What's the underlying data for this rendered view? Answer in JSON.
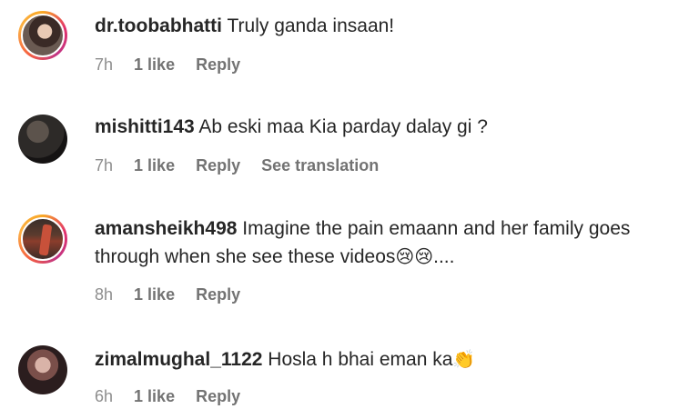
{
  "comments": [
    {
      "username": "dr.toobabhatti",
      "text": "Truly ganda insaan!",
      "time": "7h",
      "likes": "1 like",
      "reply": "Reply",
      "translate": ""
    },
    {
      "username": "mishitti143",
      "text": "Ab eski maa Kia parday dalay gi ?",
      "time": "7h",
      "likes": "1 like",
      "reply": "Reply",
      "translate": "See translation"
    },
    {
      "username": "amansheikh498",
      "text": "Imagine the pain emaann and her family goes through when she see these videos",
      "emoji": "😢😢",
      "suffix": "....",
      "time": "8h",
      "likes": "1 like",
      "reply": "Reply",
      "translate": ""
    },
    {
      "username": "zimalmughal_1122",
      "text": "Hosla h bhai eman ka",
      "emoji": "👏",
      "time": "6h",
      "likes": "1 like",
      "reply": "Reply",
      "translate": ""
    }
  ]
}
